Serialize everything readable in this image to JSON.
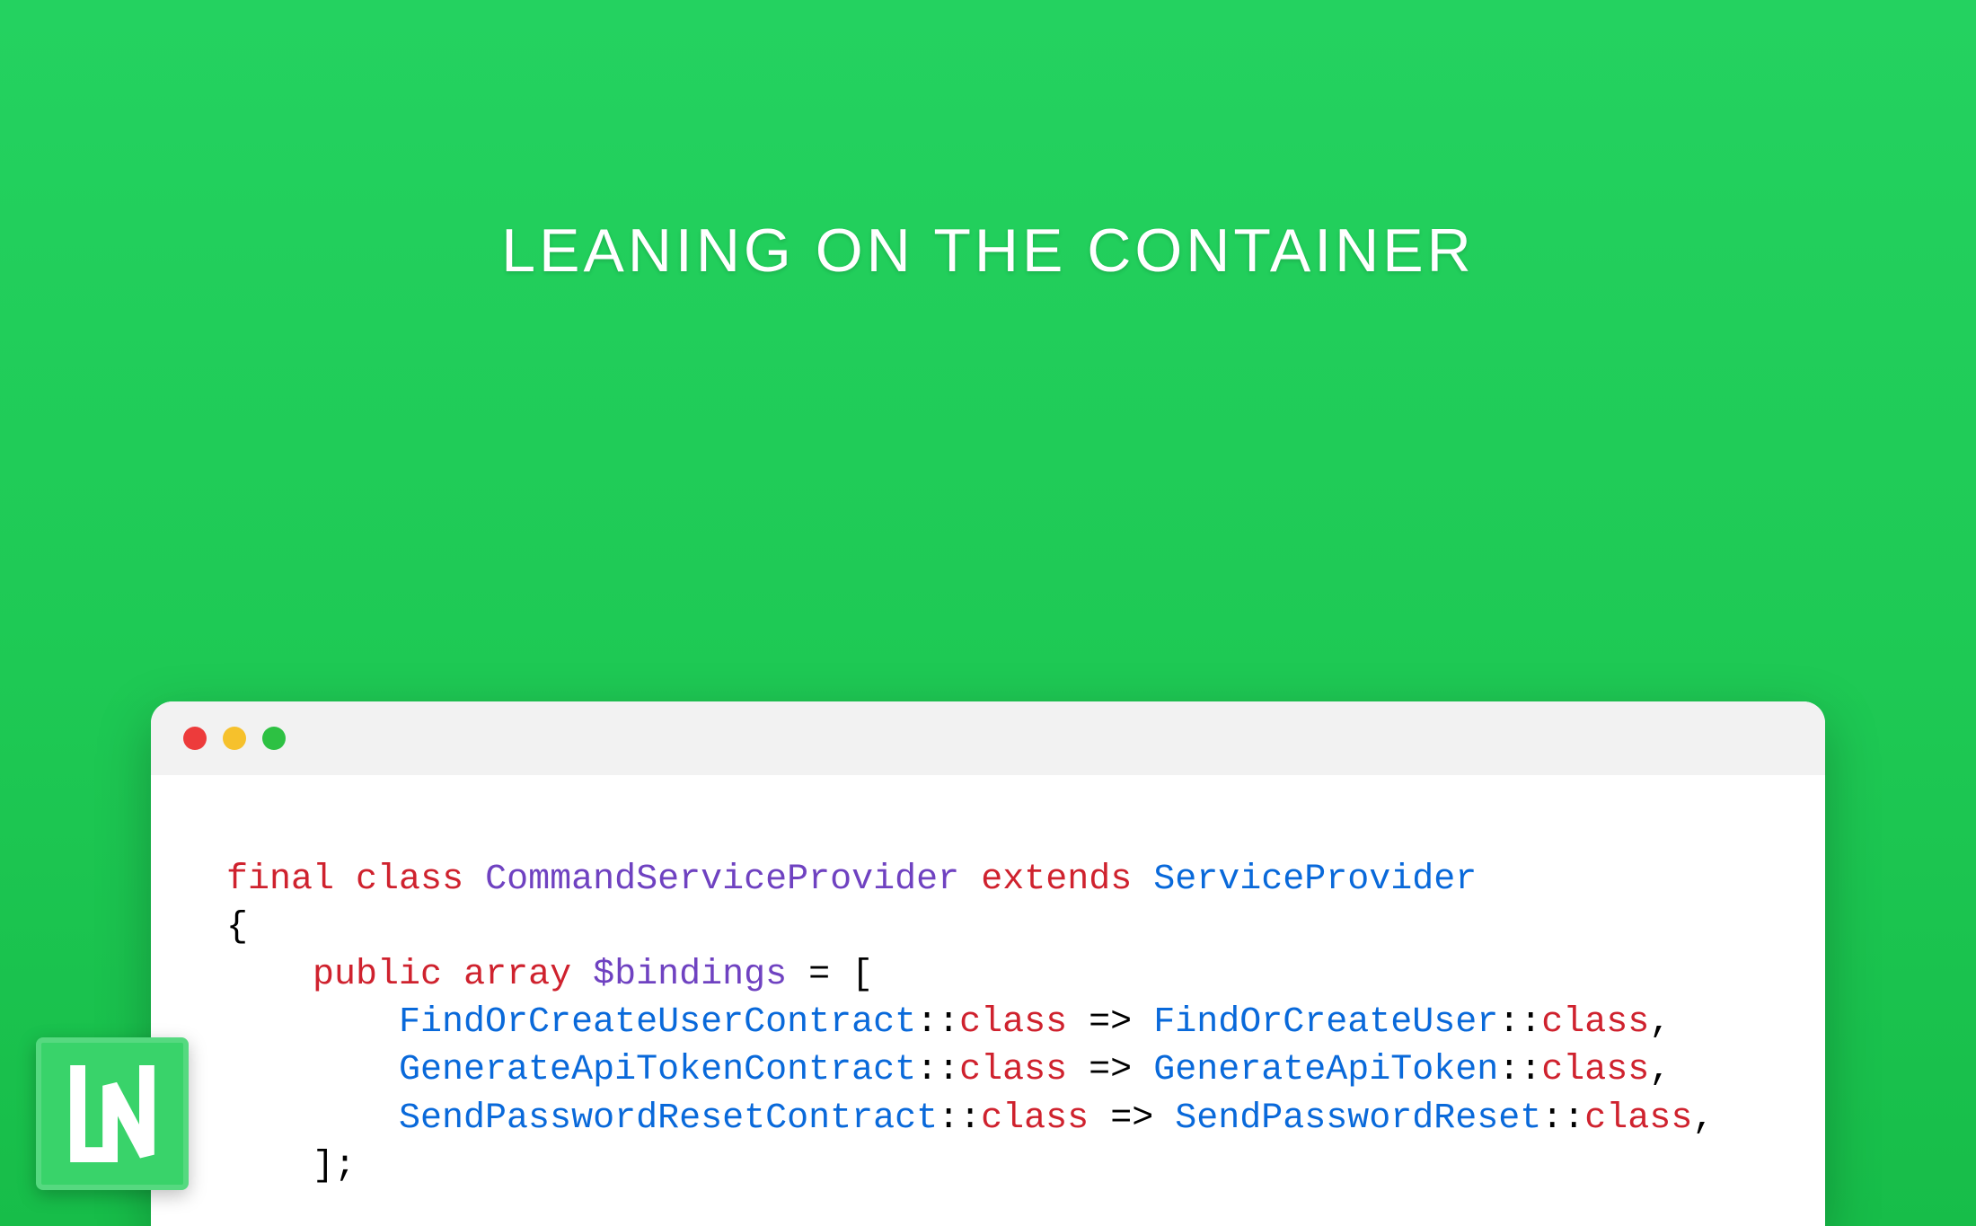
{
  "title": "LEANING ON THE CONTAINER",
  "logo_text": "LN",
  "traffic_lights": {
    "red": "#ed3b3b",
    "yellow": "#f6c12c",
    "green": "#2dc143"
  },
  "code": {
    "line1": {
      "kw1": "final",
      "kw2": "class",
      "name": "CommandServiceProvider",
      "kw3": "extends",
      "parent": "ServiceProvider"
    },
    "line2": "{",
    "line3": {
      "kw1": "public",
      "kw2": "array",
      "var": "$bindings",
      "rest": " = ["
    },
    "bindings": [
      {
        "contract": "FindOrCreateUserContract",
        "impl": "FindOrCreateUser"
      },
      {
        "contract": "GenerateApiTokenContract",
        "impl": "GenerateApiToken"
      },
      {
        "contract": "SendPasswordResetContract",
        "impl": "SendPasswordReset"
      }
    ],
    "close": "    ];"
  }
}
